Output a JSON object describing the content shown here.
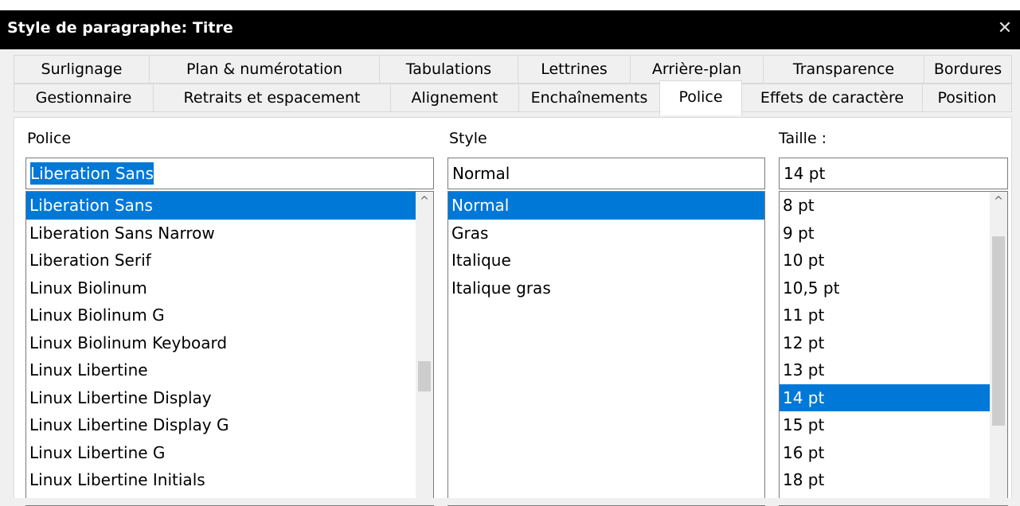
{
  "window": {
    "title": "Style de paragraphe: Titre",
    "close_glyph": "✕"
  },
  "tabs": {
    "row1": [
      "Surlignage",
      "Plan & numérotation",
      "Tabulations",
      "Lettrines",
      "Arrière-plan",
      "Transparence",
      "Bordures"
    ],
    "row2": [
      "Gestionnaire",
      "Retraits et espacement",
      "Alignement",
      "Enchaînements",
      "Police",
      "Effets de caractère",
      "Position"
    ],
    "active": "Police"
  },
  "font": {
    "label": "Police",
    "value": "Liberation Sans",
    "items": [
      "Liberation Sans",
      "Liberation Sans Narrow",
      "Liberation Serif",
      "Linux Biolinum",
      "Linux Biolinum G",
      "Linux Biolinum Keyboard",
      "Linux Libertine",
      "Linux Libertine Display",
      "Linux Libertine Display G",
      "Linux Libertine G",
      "Linux Libertine Initials"
    ],
    "selected": "Liberation Sans"
  },
  "style": {
    "label": "Style",
    "value": "Normal",
    "items": [
      "Normal",
      "Gras",
      "Italique",
      "Italique gras"
    ],
    "selected": "Normal"
  },
  "size": {
    "label": "Taille :",
    "value": "14 pt",
    "items": [
      "8 pt",
      "9 pt",
      "10 pt",
      "10,5 pt",
      "11 pt",
      "12 pt",
      "13 pt",
      "14 pt",
      "15 pt",
      "16 pt",
      "18 pt"
    ],
    "selected": "14 pt"
  },
  "icons": {
    "scroll_up": "chevron-up-icon",
    "close": "close-icon"
  },
  "colors": {
    "selection": "#0078d7",
    "titlebar": "#000000"
  }
}
